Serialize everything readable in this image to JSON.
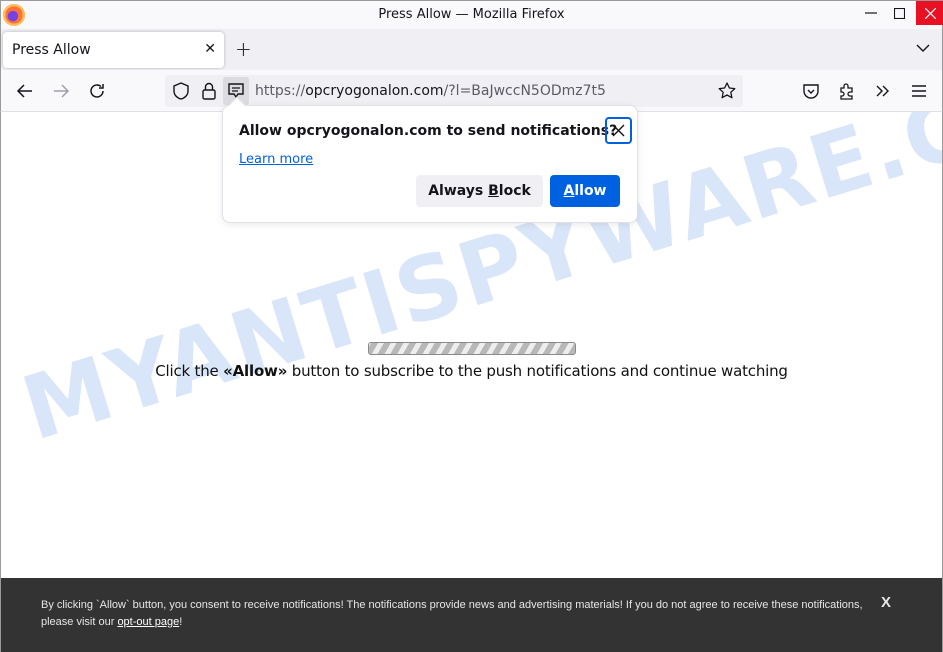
{
  "window": {
    "title": "Press Allow — Mozilla Firefox",
    "minimize_icon": "minimize-icon",
    "maximize_icon": "maximize-icon",
    "close_icon": "close-icon"
  },
  "tabs": [
    {
      "label": "Press Allow",
      "active": true
    }
  ],
  "toolbar": {
    "new_tab_glyph": "+",
    "tab_close_glyph": "✕",
    "url_scheme": "https://",
    "url_host": "opcryogonalon.com",
    "url_path": "/?l=BaJwccN5ODmz7t5",
    "icons": [
      "back-arrow-icon",
      "forward-arrow-icon",
      "reload-icon",
      "shield-icon",
      "lock-icon",
      "notification-permission-icon",
      "bookmark-star-icon",
      "pocket-icon",
      "extensions-icon",
      "overflow-chevrons-icon",
      "hamburger-menu-icon"
    ]
  },
  "popup": {
    "message": "Allow opcryogonalon.com to send notifications?",
    "learn_more": "Learn more",
    "block_prefix": "Always ",
    "block_accel": "B",
    "block_suffix": "lock",
    "allow_accel": "A",
    "allow_suffix": "llow"
  },
  "page": {
    "watermark": "MYANTISPYWARE.COM",
    "cta_before": "Click the ",
    "cta_bold": "«Allow»",
    "cta_after": " button to subscribe to the push notifications and continue watching"
  },
  "consent": {
    "text_before": "By clicking `Allow` button, you consent to receive notifications! The notifications provide news and advertising materials! If you do not agree to receive these notifications, please visit our ",
    "link": "opt-out page",
    "text_after": "!",
    "close_glyph": "X"
  },
  "colors": {
    "accent": "#0061e0",
    "close_red": "#e81123",
    "consent_bg": "#333333"
  }
}
